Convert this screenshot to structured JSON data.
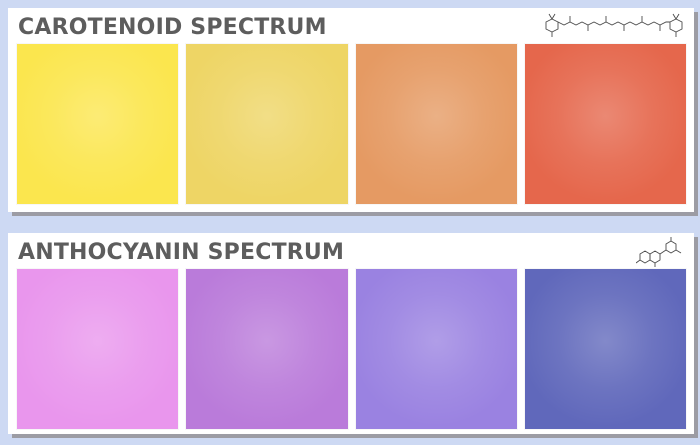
{
  "panels": [
    {
      "title": "CAROTENOID SPECTRUM",
      "structure_icon": "carotenoid-structure-icon",
      "swatches": [
        "#fbe64e",
        "#eed565",
        "#e59a63",
        "#e5674c"
      ]
    },
    {
      "title": "ANTHOCYANIN SPECTRUM",
      "structure_icon": "anthocyanin-structure-icon",
      "swatches": [
        "#e996ed",
        "#ba7bda",
        "#9a82e1",
        "#6068bb"
      ]
    }
  ]
}
